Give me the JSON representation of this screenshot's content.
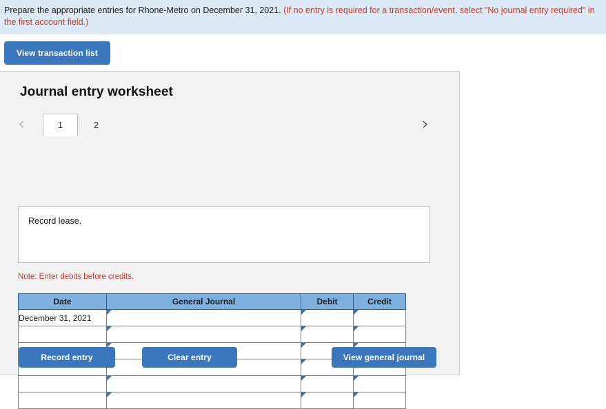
{
  "banner": {
    "instruction": "Prepare the appropriate entries for Rhone-Metro on December 31, 2021. ",
    "requirement_note": "(If no entry is required for a transaction/event, select \"No journal entry required\" in the first account field.)"
  },
  "toolbar": {
    "view_transaction_list_label": "View transaction list"
  },
  "worksheet": {
    "title": "Journal entry worksheet",
    "prev_icon": "‹",
    "next_icon": "›",
    "tabs": [
      {
        "label": "1",
        "active": true
      },
      {
        "label": "2",
        "active": false
      }
    ],
    "description": "Record lease.",
    "note": "Note: Enter debits before credits."
  },
  "table": {
    "headers": [
      "Date",
      "General Journal",
      "Debit",
      "Credit"
    ],
    "rows": [
      {
        "date": "December 31, 2021",
        "general_journal": "",
        "debit": "",
        "credit": ""
      },
      {
        "date": "",
        "general_journal": "",
        "debit": "",
        "credit": ""
      },
      {
        "date": "",
        "general_journal": "",
        "debit": "",
        "credit": ""
      },
      {
        "date": "",
        "general_journal": "",
        "debit": "",
        "credit": ""
      },
      {
        "date": "",
        "general_journal": "",
        "debit": "",
        "credit": ""
      },
      {
        "date": "",
        "general_journal": "",
        "debit": "",
        "credit": ""
      }
    ]
  },
  "actions": {
    "record_entry_label": "Record entry",
    "clear_entry_label": "Clear entry",
    "view_general_journal_label": "View general journal"
  },
  "colors": {
    "banner_background": "#dceaf5",
    "accent_red": "#c0392b",
    "button_blue": "#3a77bd",
    "table_header_blue": "#7eb0e0",
    "input_border_blue": "#41729f",
    "panel_background": "#f2f2f2"
  }
}
